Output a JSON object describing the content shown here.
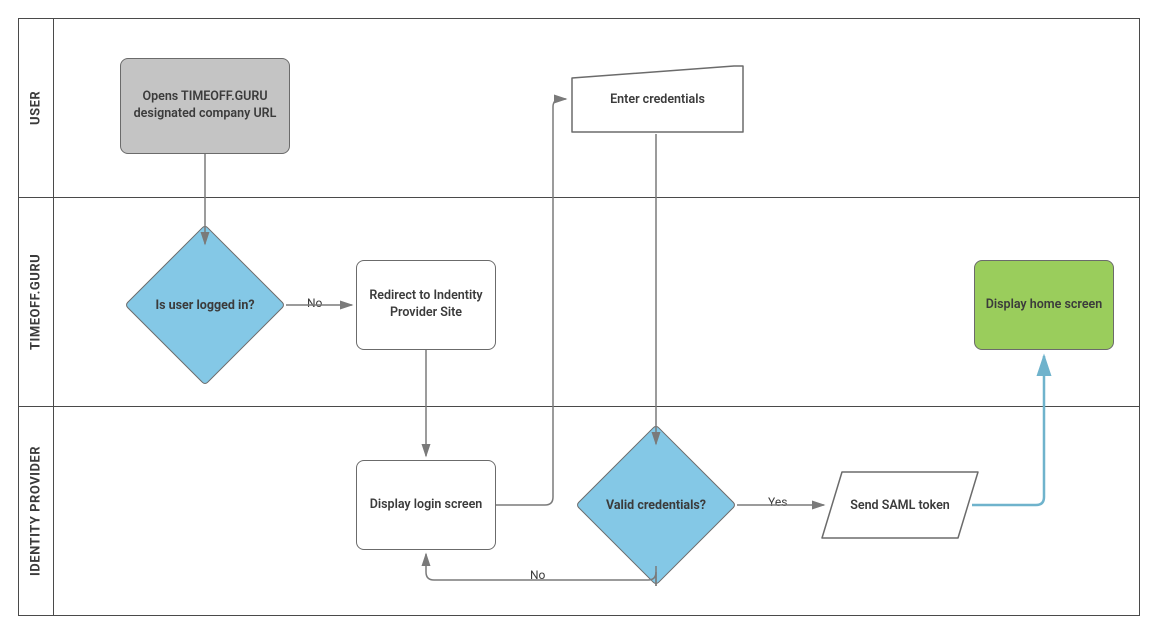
{
  "lanes": {
    "user": "USER",
    "app": "TIMEOFF.GURU",
    "idp": "IDENTITY PROVIDER"
  },
  "nodes": {
    "open_url": "Opens TIMEOFF.GURU designated company URL",
    "logged_in": "Is user logged in?",
    "redirect": "Redirect to Indentity Provider Site",
    "display_login": "Display login screen",
    "enter_creds": "Enter credentials",
    "valid_creds": "Valid credentials?",
    "send_saml": "Send SAML token",
    "display_home": "Display home screen"
  },
  "edges": {
    "no1": "No",
    "no2": "No",
    "yes": "Yes"
  }
}
